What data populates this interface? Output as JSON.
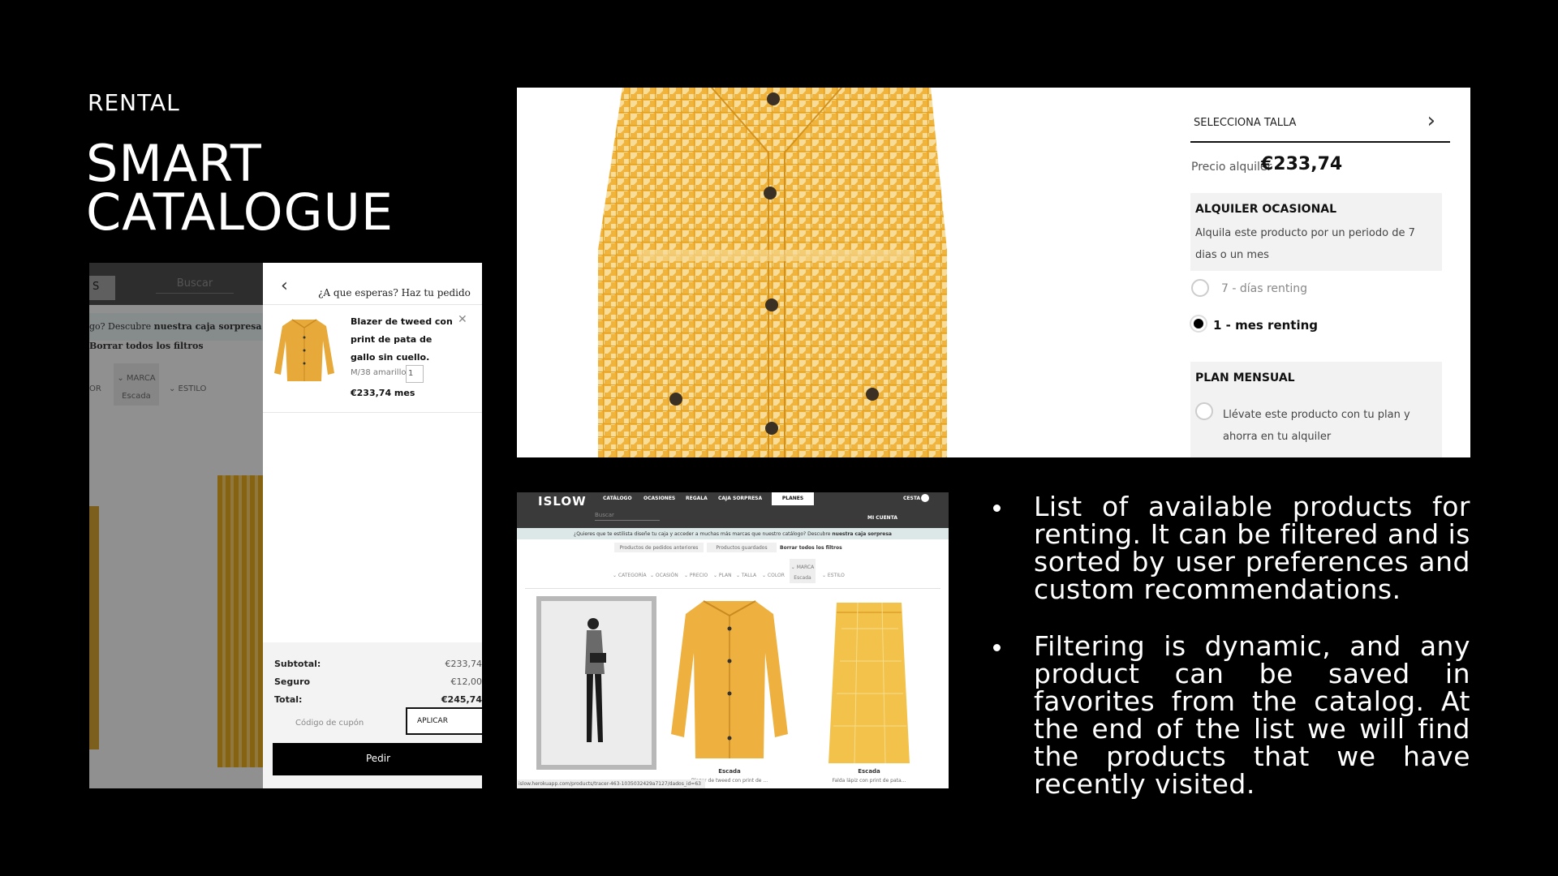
{
  "slide": {
    "eyebrow": "RENTAL",
    "title_line1": "SMART",
    "title_line2": "CATALOGUE"
  },
  "cart_panel": {
    "left": {
      "box_text": "S",
      "search_label": "Buscar",
      "promo_prefix": "go? Descubre ",
      "promo_bold": "nuestra caja sorpresa",
      "clear_filters": "Borrar todos los filtros",
      "filter_marca": "⌄ MARCA",
      "filter_marca_value": "Escada",
      "filter_estilo": "⌄ ESTILO",
      "filter_or": "OR"
    },
    "header": {
      "back_icon": "chevron-left-icon",
      "title": "¿A que esperas? Haz tu pedido"
    },
    "item": {
      "name": "Blazer de tweed con print de pata de gallo sin cuello.",
      "variant": "M/38 amarillo",
      "quantity": "1",
      "price": "€233,74 mes"
    },
    "totals": {
      "subtotal_label": "Subtotal:",
      "subtotal_value": "€233,74",
      "insurance_label": "Seguro",
      "insurance_value": "€12,00",
      "total_label": "Total:",
      "total_value": "€245,74"
    },
    "coupon_placeholder": "Código de cupón",
    "apply_label": "APLICAR",
    "order_label": "Pedir"
  },
  "detail_panel": {
    "size_label": "SELECCIONA TALLA",
    "rent_label": "Precio alquiler",
    "rent_price": "€233,74",
    "occasional_title": "ALQUILER OCASIONAL",
    "occasional_desc": "Alquila este producto por un periodo de 7 dias o un mes",
    "option1": "7 - días renting",
    "option2": "1 - mes renting",
    "option2_selected": true,
    "plan_title": "PLAN MENSUAL",
    "plan_desc": "Llévate este producto con tu plan y ahorra en tu alquiler"
  },
  "catalogue_panel": {
    "logo": "ISLOW",
    "menu": [
      "CATÁLOGO",
      "OCASIONES",
      "REGALA",
      "CAJA SORPRESA"
    ],
    "planes": "PLANES",
    "cart": "CESTA",
    "search": "Buscar",
    "account": "MI CUENTA",
    "promo_prefix": "¿Quieres que te estilista diseñe tu caja y acceder a muchas más marcas que nuestro catálogo? Descubre ",
    "promo_bold": "nuestra caja sorpresa",
    "tabs": [
      "Productos de pedidos anteriores",
      "Productos guardados"
    ],
    "clear_filters": "Borrar todos los filtros",
    "filters": [
      "⌄ CATEGORÍA",
      "⌄ OCASIÓN",
      "⌄ PRECIO",
      "⌄ PLAN",
      "⌄ TALLA",
      "⌄ COLOR"
    ],
    "filter_marca": "⌄ MARCA",
    "filter_marca_value": "Escada",
    "filter_estilo": "⌄ ESTILO",
    "products": [
      {
        "brand": "",
        "desc": ""
      },
      {
        "brand": "Escada",
        "desc": "Blazer de tweed con print de ..."
      },
      {
        "brand": "Escada",
        "desc": "Falda lápiz con print de pata..."
      }
    ],
    "status_url": "islow.herokuapp.com/products/tracer-463-1035032429a7127/dados_id=63"
  },
  "bullets": [
    "List of available products for renting. It can be filtered and is sorted by user preferences and custom recommendations.",
    "Filtering is dynamic, and any product can be saved in favorites from the catalog. At the end of the list we will find the products that we have recently visited."
  ]
}
